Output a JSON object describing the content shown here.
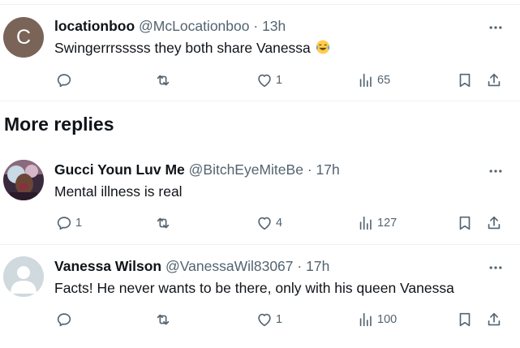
{
  "posts": [
    {
      "name": "locationboo",
      "handle": "@McLocationboo",
      "separator": "·",
      "time": "13h",
      "avatar_letter": "C",
      "avatar_color": "#7a6357",
      "text": "Swingerrrsssss they both share Vanessa",
      "emoji": "face-with-tears-of-joy",
      "replies": "",
      "reposts": "",
      "likes": "1",
      "views": "65"
    },
    {
      "name": "Gucci Youn Luv Me",
      "handle": "@BitchEyeMiteBe",
      "separator": "·",
      "time": "17h",
      "text": "Mental illness is real",
      "replies": "1",
      "reposts": "",
      "likes": "4",
      "views": "127"
    },
    {
      "name": "Vanessa Wilson",
      "handle": "@VanessaWil83067",
      "separator": "·",
      "time": "17h",
      "text": "Facts! He never wants to be there, only with his queen Vanessa",
      "replies": "",
      "reposts": "",
      "likes": "1",
      "views": "100"
    }
  ],
  "more_replies_label": "More replies",
  "colors": {
    "text": "#0f1419",
    "secondary": "#536471",
    "border": "#eff3f4"
  }
}
